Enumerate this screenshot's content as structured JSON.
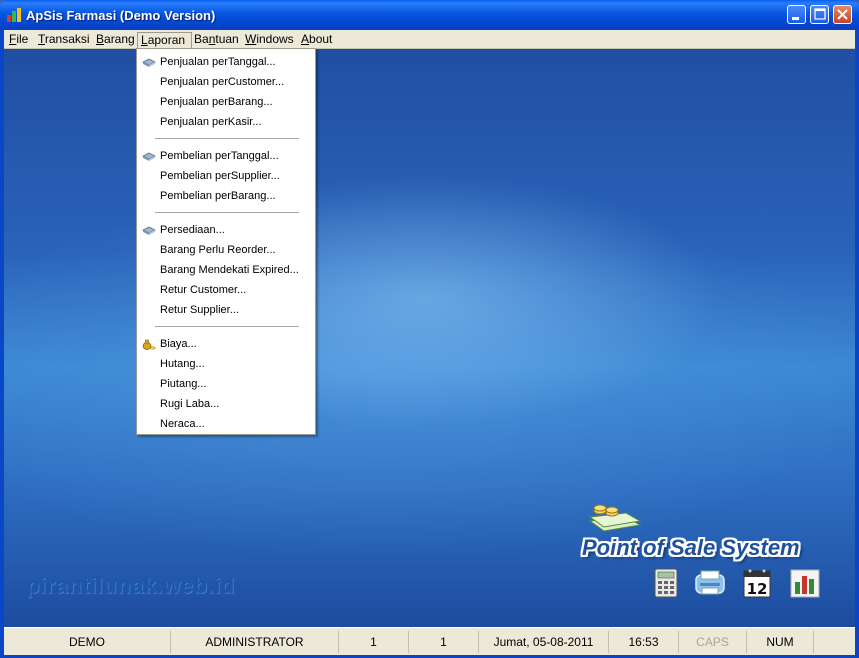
{
  "window": {
    "title": "ApSis Farmasi (Demo Version)",
    "controls": [
      "minimize",
      "maximize",
      "close"
    ]
  },
  "menubar": {
    "items": [
      {
        "first": "F",
        "rest": "ile"
      },
      {
        "first": "T",
        "rest": "ransaksi"
      },
      {
        "first": "B",
        "rest": "arang"
      },
      {
        "first": "L",
        "rest": "aporan"
      },
      {
        "first": "Ba",
        "ul": "n",
        "rest": "tuan"
      },
      {
        "first": "W",
        "rest": "indows"
      },
      {
        "first": "A",
        "rest": "bout"
      }
    ],
    "open_index": 3
  },
  "dropdown": {
    "items": [
      {
        "label": "Penjualan perTanggal...",
        "icon": "report-icon"
      },
      {
        "label": "Penjualan perCustomer..."
      },
      {
        "label": "Penjualan perBarang..."
      },
      {
        "label": "Penjualan perKasir..."
      },
      {
        "label": "Pembelian perTanggal...",
        "icon": "report-icon"
      },
      {
        "label": "Pembelian perSupplier..."
      },
      {
        "label": "Pembelian perBarang..."
      },
      {
        "label": "Persediaan...",
        "icon": "report-icon"
      },
      {
        "label": "Barang Perlu Reorder..."
      },
      {
        "label": "Barang Mendekati Expired..."
      },
      {
        "label": "Retur Customer..."
      },
      {
        "label": "Retur Supplier..."
      },
      {
        "label": "Biaya...",
        "icon": "money-bag-icon"
      },
      {
        "label": "Hutang..."
      },
      {
        "label": "Piutang..."
      },
      {
        "label": "Rugi Laba..."
      },
      {
        "label": "Neraca..."
      }
    ]
  },
  "desktop": {
    "watermark": "pirantilunak.web.id",
    "logo_text": "Point of Sale System",
    "icons": [
      "calculator-icon",
      "printer-icon",
      "calendar-icon",
      "chart-icon"
    ],
    "calendar_day": "12"
  },
  "statusbar": {
    "panels": [
      "DEMO",
      "ADMINISTRATOR",
      "1",
      "1",
      "Jumat, 05-08-2011",
      "16:53",
      "CAPS",
      "NUM"
    ]
  },
  "colors": {
    "titlebar": "#0755e0",
    "menubar": "#ece9d8",
    "desktop": "#2f64b8"
  }
}
